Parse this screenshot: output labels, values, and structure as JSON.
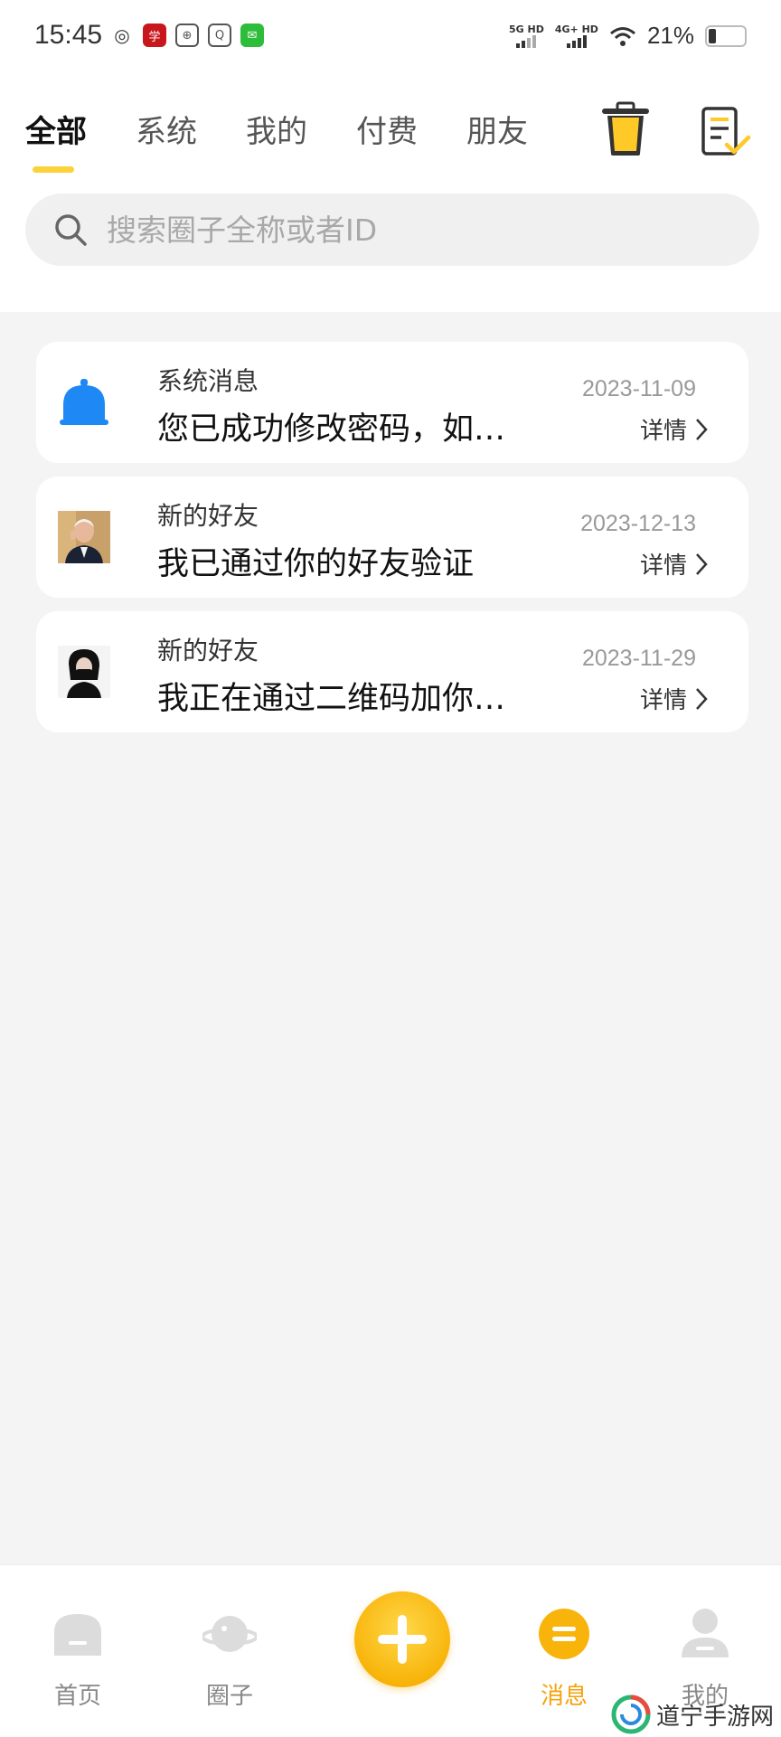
{
  "status_bar": {
    "time": "15:45",
    "network1": "5G HD",
    "network2": "4G+ HD",
    "battery": "21%",
    "app_icons": [
      "weibo-icon",
      "xuexi-icon",
      "bank-icon",
      "search-app-icon",
      "wechat-icon"
    ]
  },
  "tabs": [
    {
      "label": "全部",
      "active": true
    },
    {
      "label": "系统",
      "active": false
    },
    {
      "label": "我的",
      "active": false
    },
    {
      "label": "付费",
      "active": false
    },
    {
      "label": "朋友",
      "active": false
    }
  ],
  "search": {
    "placeholder": "搜索圈子全称或者ID"
  },
  "messages": [
    {
      "title": "系统消息",
      "text": "您已成功修改密码，如…",
      "date": "2023-11-09",
      "detail": "详情",
      "avatar": "bell-icon"
    },
    {
      "title": "新的好友",
      "text": "我已通过你的好友验证",
      "date": "2023-12-13",
      "detail": "详情",
      "avatar": "user-avatar-photo"
    },
    {
      "title": "新的好友",
      "text": "我正在通过二维码加你…",
      "date": "2023-11-29",
      "detail": "详情",
      "avatar": "user-avatar-photo"
    }
  ],
  "bottom_nav": [
    {
      "label": "首页",
      "icon": "home-icon",
      "active": false
    },
    {
      "label": "圈子",
      "icon": "planet-icon",
      "active": false
    },
    {
      "label": "消息",
      "icon": "message-icon",
      "active": true
    },
    {
      "label": "我的",
      "icon": "profile-icon",
      "active": false
    }
  ],
  "watermark": "道宁手游网",
  "colors": {
    "accent": "#fbd23a",
    "nav_active": "#f5a20c",
    "bell": "#1e88f5",
    "background": "#f4f4f4"
  }
}
